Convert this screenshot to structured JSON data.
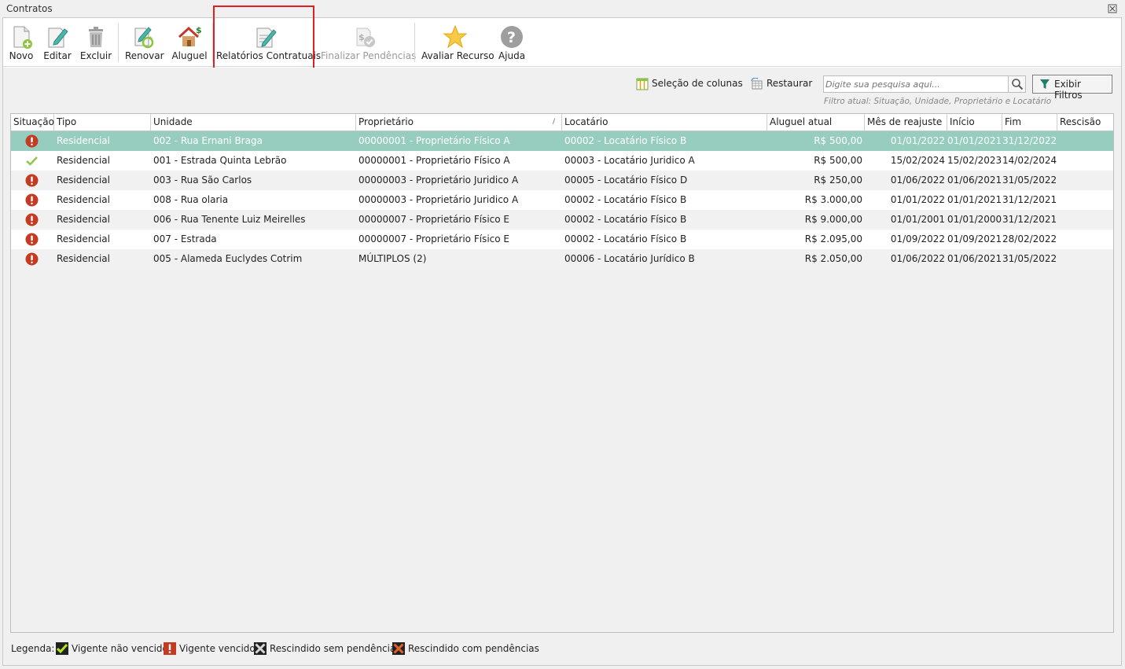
{
  "window": {
    "title": "Contratos"
  },
  "toolbar": {
    "novo": "Novo",
    "editar": "Editar",
    "excluir": "Excluir",
    "renovar": "Renovar",
    "aluguel": "Aluguel",
    "relatorios": "Relatórios Contratuais",
    "finalizar": "Finalizar Pendências",
    "avaliar": "Avaliar Recurso",
    "ajuda": "Ajuda"
  },
  "actions": {
    "selecao_colunas": "Seleção de colunas",
    "restaurar": "Restaurar",
    "exibir_filtros": "Exibir Filtros"
  },
  "search": {
    "placeholder": "Digite sua pesquisa aqui...",
    "filtro_atual": "Filtro atual: Situação, Unidade, Proprietário e Locatário"
  },
  "table": {
    "columns": [
      "Situação",
      "Tipo",
      "Unidade",
      "Proprietário",
      "Locatário",
      "Aluguel atual",
      "Mês de reajuste",
      "Início",
      "Fim",
      "Rescisão"
    ],
    "sort_indicator": "/",
    "rows": [
      {
        "status": "vencido",
        "tipo": "Residencial",
        "unidade": "002 - Rua Ernani Braga",
        "proprietario": "00000001 - Proprietário Físico A",
        "locatario": "00002 - Locatário Físico B",
        "aluguel": "R$ 500,00",
        "reajuste": "01/01/2022",
        "inicio": "01/01/2021",
        "fim": "31/12/2022",
        "rescisao": ""
      },
      {
        "status": "vigente",
        "tipo": "Residencial",
        "unidade": "001 - Estrada Quinta Lebrão",
        "proprietario": "00000001 - Proprietário Físico A",
        "locatario": "00003 - Locatário Juridico A",
        "aluguel": "R$ 500,00",
        "reajuste": "15/02/2024",
        "inicio": "15/02/2023",
        "fim": "14/02/2024",
        "rescisao": ""
      },
      {
        "status": "vencido",
        "tipo": "Residencial",
        "unidade": "003 - Rua São Carlos",
        "proprietario": "00000003 - Proprietário Juridico A",
        "locatario": "00005 - Locatário Físico D",
        "aluguel": "R$ 250,00",
        "reajuste": "01/06/2022",
        "inicio": "01/06/2021",
        "fim": "31/05/2022",
        "rescisao": ""
      },
      {
        "status": "vencido",
        "tipo": "Residencial",
        "unidade": "008 - Rua olaria",
        "proprietario": "00000003 - Proprietário Juridico A",
        "locatario": "00002 - Locatário Físico B",
        "aluguel": "R$ 3.000,00",
        "reajuste": "01/01/2022",
        "inicio": "01/01/2021",
        "fim": "31/12/2021",
        "rescisao": ""
      },
      {
        "status": "vencido",
        "tipo": "Residencial",
        "unidade": "006 - Rua Tenente Luiz Meirelles",
        "proprietario": "00000007 - Proprietário Físico E",
        "locatario": "00002 - Locatário Físico B",
        "aluguel": "R$ 9.000,00",
        "reajuste": "01/01/2001",
        "inicio": "01/01/2000",
        "fim": "31/12/2021",
        "rescisao": ""
      },
      {
        "status": "vencido",
        "tipo": "Residencial",
        "unidade": "007 - Estrada",
        "proprietario": "00000007 - Proprietário Físico E",
        "locatario": "00002 - Locatário Físico B",
        "aluguel": "R$ 2.095,00",
        "reajuste": "01/09/2022",
        "inicio": "01/09/2021",
        "fim": "28/02/2022",
        "rescisao": ""
      },
      {
        "status": "vencido",
        "tipo": "Residencial",
        "unidade": "005 - Alameda Euclydes Cotrim",
        "proprietario": "MÚLTIPLOS (2)",
        "locatario": "00006 - Locatário Jurídico B",
        "aluguel": "R$ 2.050,00",
        "reajuste": "01/06/2022",
        "inicio": "01/06/2021",
        "fim": "31/05/2022",
        "rescisao": ""
      }
    ]
  },
  "legend": {
    "label": "Legenda:",
    "vigente_nao_vencido": "Vigente não vencido",
    "vigente_vencido": "Vigente vencido",
    "rescindido_sem": "Rescindido sem pendências",
    "rescindido_com": "Rescindido com pendências"
  },
  "colors": {
    "selected_row": "#97cdbf",
    "alert_red": "#c23b22",
    "check_green": "#8cc63f",
    "highlight_box": "#e02020"
  }
}
